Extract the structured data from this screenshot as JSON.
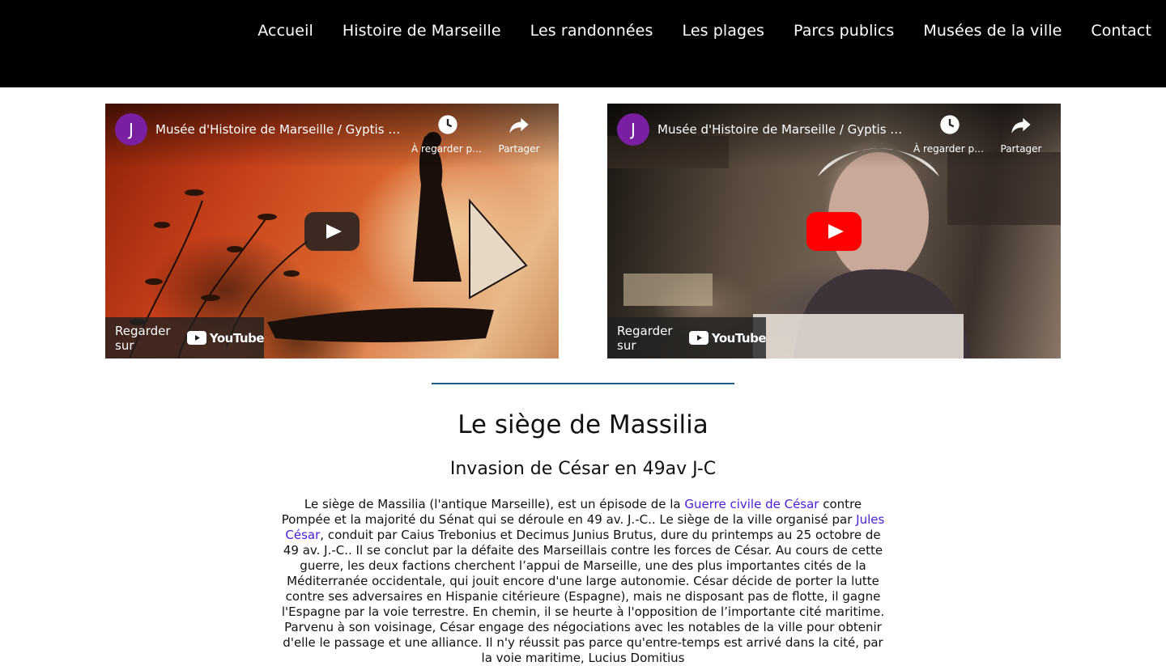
{
  "nav": {
    "items": [
      {
        "label": "Accueil"
      },
      {
        "label": "Histoire de Marseille"
      },
      {
        "label": "Les randonnées"
      },
      {
        "label": "Les plages"
      },
      {
        "label": "Parcs publics"
      },
      {
        "label": "Musées de la ville"
      },
      {
        "label": "Contact"
      }
    ]
  },
  "videos": [
    {
      "avatar": "J",
      "title": "Musée d'Histoire de Marseille / Gyptis et Protis",
      "watch_later_label": "À regarder plus tard",
      "share_label": "Partager",
      "watch_on_label": "Regarder sur",
      "platform": "YouTube"
    },
    {
      "avatar": "J",
      "title": "Musée d'Histoire de Marseille / Gyptis et Protis",
      "watch_later_label": "À regarder plus tard",
      "share_label": "Partager",
      "watch_on_label": "Regarder sur",
      "platform": "YouTube"
    }
  ],
  "article": {
    "title": "Le siège de Massilia",
    "subtitle": "Invasion de César en 49av J-C",
    "p1": "Le siège de Massilia (l'antique Marseille), est un épisode de la ",
    "link1": "Guerre civile de César",
    "p2": " contre Pompée et la majorité du Sénat qui se déroule en 49 av. J.-C.. Le siège de la ville organisé par ",
    "link2": "Jules César",
    "p3": ", conduit par Caius Trebonius et Decimus Junius Brutus, dure du printemps au 25 octobre de 49 av. J.-C.. Il se conclut par la défaite des Marseillais contre les forces de César. Au cours de cette guerre, les deux factions cherchent l’appui de Marseille, une des plus importantes cités de la Méditerranée occidentale, qui jouit encore d'une large autonomie. César décide de porter la lutte contre ses adversaires en Hispanie citérieure (Espagne), mais ne disposant pas de flotte, il gagne l'Espagne par la voie terrestre. En chemin, il se heurte à l'opposition de l’importante cité maritime. Parvenu à son voisinage, César engage des négociations avec les notables de la ville pour obtenir d'elle le passage et une alliance. Il n'y réussit pas parce qu'entre-temps est arrivé dans la cité, par la voie maritime, Lucius Domitius"
  },
  "colors": {
    "nav_bg": "#000000",
    "rule": "#1f5e85",
    "link": "#4a1cd6",
    "youtube_red": "#ff0000",
    "avatar": "#7b1fa2"
  }
}
